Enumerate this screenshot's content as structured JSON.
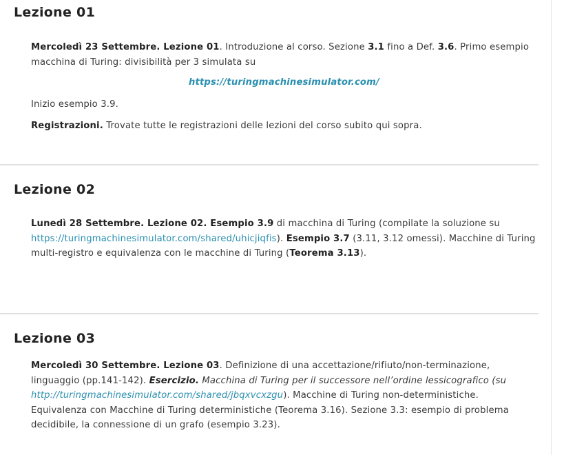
{
  "lessons": [
    {
      "title": "Lezione 01",
      "p1": {
        "date": "Mercoledì 23 Settembre. Lezione 01",
        "t1": ". Introduzione al corso. Sezione ",
        "b1": "3.1",
        "t2": " fino a Def. ",
        "b2": "3.6",
        "t3": ". Primo esempio macchina di Turing: divisibilità per 3 simulata su"
      },
      "link_center": "https://turingmachinesimulator.com/",
      "p2": "Inizio esempio 3.9.",
      "p3": {
        "bold": "Registrazioni.",
        "text": " Trovate tutte le registrazioni delle lezioni del corso subito qui sopra."
      }
    },
    {
      "title": "Lezione 02",
      "p1": {
        "date": "Lunedì 28 Settembre. Lezione 02. Esempio 3.9",
        "t1": " di macchina di Turing (compilate la soluzione su ",
        "link": "https://turingmachinesimulator.com/shared/uhicjiqfis",
        "t2": "). ",
        "b1": "Esempio 3.7",
        "t3": " (3.11, 3.12 omessi). Macchine di Turing multi-registro e equivalenza con le macchine di Turing (",
        "b2": "Teorema 3.13",
        "t4": ")."
      }
    },
    {
      "title": "Lezione 03",
      "p1": {
        "date": "Mercoledì 30 Settembre. Lezione 03",
        "t1": ". Definizione di una accettazione/rifiuto/non-terminazione, linguaggio (pp.141-142). ",
        "ex": "Esercizio.",
        "it": " Macchina di Turing per il successore nell’ordine lessicografico (su ",
        "link": "http://turingmachinesimulator.com/shared/jbqxvcxzgu",
        "t2": "). Macchine di Turing non-deterministiche. Equivalenza con Macchine di Turing deterministiche (Teorema 3.16). Sezione 3.3: esempio di problema decidibile, la connessione di un grafo (esempio 3.23)."
      }
    }
  ]
}
